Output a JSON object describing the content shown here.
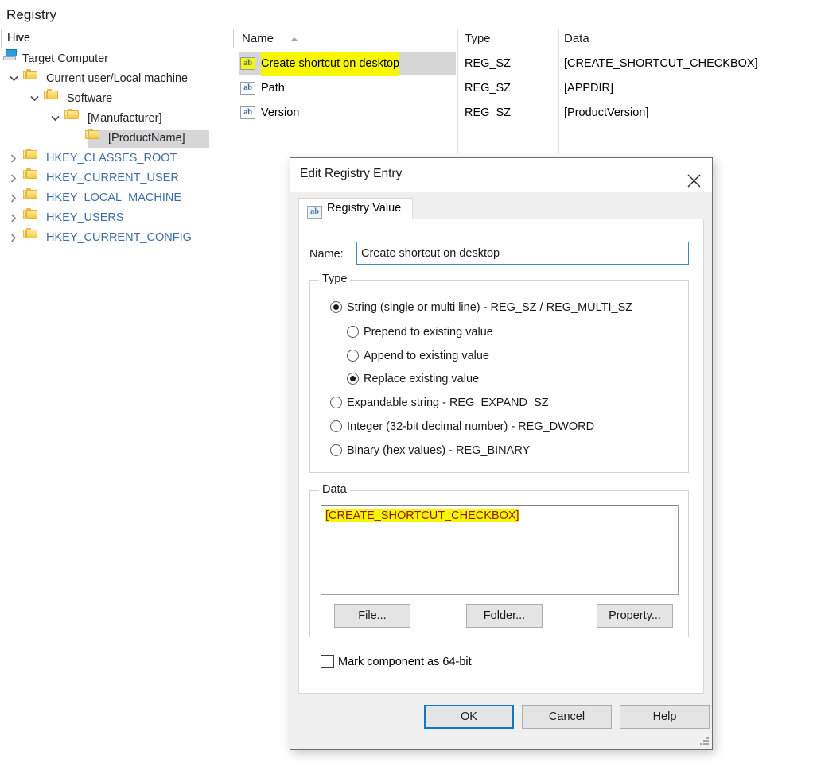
{
  "app": {
    "title": "Registry"
  },
  "tree": {
    "header": "Hive",
    "items": [
      {
        "label": "Target Computer",
        "icon": "computer-icon",
        "indent": 0,
        "twisty": "none",
        "style": "plain",
        "selected": false
      },
      {
        "label": "Current user/Local machine",
        "icon": "folder-icon",
        "indent": 1,
        "twisty": "expanded",
        "style": "plain",
        "selected": false
      },
      {
        "label": "Software",
        "icon": "folder-icon",
        "indent": 2,
        "twisty": "expanded",
        "style": "plain",
        "selected": false
      },
      {
        "label": "[Manufacturer]",
        "icon": "folder-icon",
        "indent": 3,
        "twisty": "expanded",
        "style": "plain",
        "selected": false
      },
      {
        "label": "[ProductName]",
        "icon": "folder-icon",
        "indent": 4,
        "twisty": "none",
        "style": "plain",
        "selected": true
      },
      {
        "label": "HKEY_CLASSES_ROOT",
        "icon": "folder-icon",
        "indent": 1,
        "twisty": "collapsed",
        "style": "hkey",
        "selected": false
      },
      {
        "label": "HKEY_CURRENT_USER",
        "icon": "folder-icon",
        "indent": 1,
        "twisty": "collapsed",
        "style": "hkey",
        "selected": false
      },
      {
        "label": "HKEY_LOCAL_MACHINE",
        "icon": "folder-icon",
        "indent": 1,
        "twisty": "collapsed",
        "style": "hkey",
        "selected": false
      },
      {
        "label": "HKEY_USERS",
        "icon": "folder-icon",
        "indent": 1,
        "twisty": "collapsed",
        "style": "hkey",
        "selected": false
      },
      {
        "label": "HKEY_CURRENT_CONFIG",
        "icon": "folder-icon",
        "indent": 1,
        "twisty": "collapsed",
        "style": "hkey",
        "selected": false
      }
    ]
  },
  "list": {
    "columns": [
      {
        "label": "Name",
        "sorted": "ascending"
      },
      {
        "label": "Type",
        "sorted": "none"
      },
      {
        "label": "Data",
        "sorted": "none"
      }
    ],
    "rows": [
      {
        "name": "Create shortcut on desktop",
        "type": "REG_SZ",
        "data": "[CREATE_SHORTCUT_CHECKBOX]",
        "icon": "string-value-icon",
        "selected": true,
        "highlighted": true
      },
      {
        "name": "Path",
        "type": "REG_SZ",
        "data": "[APPDIR]",
        "icon": "string-value-icon",
        "selected": false,
        "highlighted": false
      },
      {
        "name": "Version",
        "type": "REG_SZ",
        "data": "[ProductVersion]",
        "icon": "string-value-icon",
        "selected": false,
        "highlighted": false
      }
    ]
  },
  "dialog": {
    "title": "Edit Registry Entry",
    "close_label": "×",
    "tab": {
      "label": "Registry Value",
      "icon_text": "ab"
    },
    "name": {
      "label": "Name:",
      "value": "Create shortcut on desktop",
      "placeholder": ""
    },
    "type_group": {
      "title": "Type",
      "options": [
        {
          "label": "String (single or multi line) - REG_SZ / REG_MULTI_SZ",
          "checked": true,
          "level": 0
        },
        {
          "label": "Prepend to existing value",
          "checked": false,
          "level": 1
        },
        {
          "label": "Append to existing value",
          "checked": false,
          "level": 1
        },
        {
          "label": "Replace existing value",
          "checked": true,
          "level": 1
        },
        {
          "label": "Expandable string - REG_EXPAND_SZ",
          "checked": false,
          "level": 0
        },
        {
          "label": "Integer (32-bit decimal number) - REG_DWORD",
          "checked": false,
          "level": 0
        },
        {
          "label": "Binary (hex values) - REG_BINARY",
          "checked": false,
          "level": 0
        }
      ]
    },
    "data_group": {
      "title": "Data",
      "value": "[CREATE_SHORTCUT_CHECKBOX]",
      "buttons": {
        "file": "File...",
        "folder": "Folder...",
        "property": "Property..."
      }
    },
    "mark64": {
      "label": "Mark component as 64-bit",
      "checked": false
    },
    "footer": {
      "ok": "OK",
      "cancel": "Cancel",
      "help": "Help"
    }
  },
  "colors": {
    "selection_gray": "#d6d6d6",
    "highlight_yellow": "#f8f700",
    "hkey_blue": "#3d6ea5",
    "data_text_red": "#8b1a10",
    "focus_blue": "#0b79c8",
    "folder_yellow": "#fbd96b"
  }
}
